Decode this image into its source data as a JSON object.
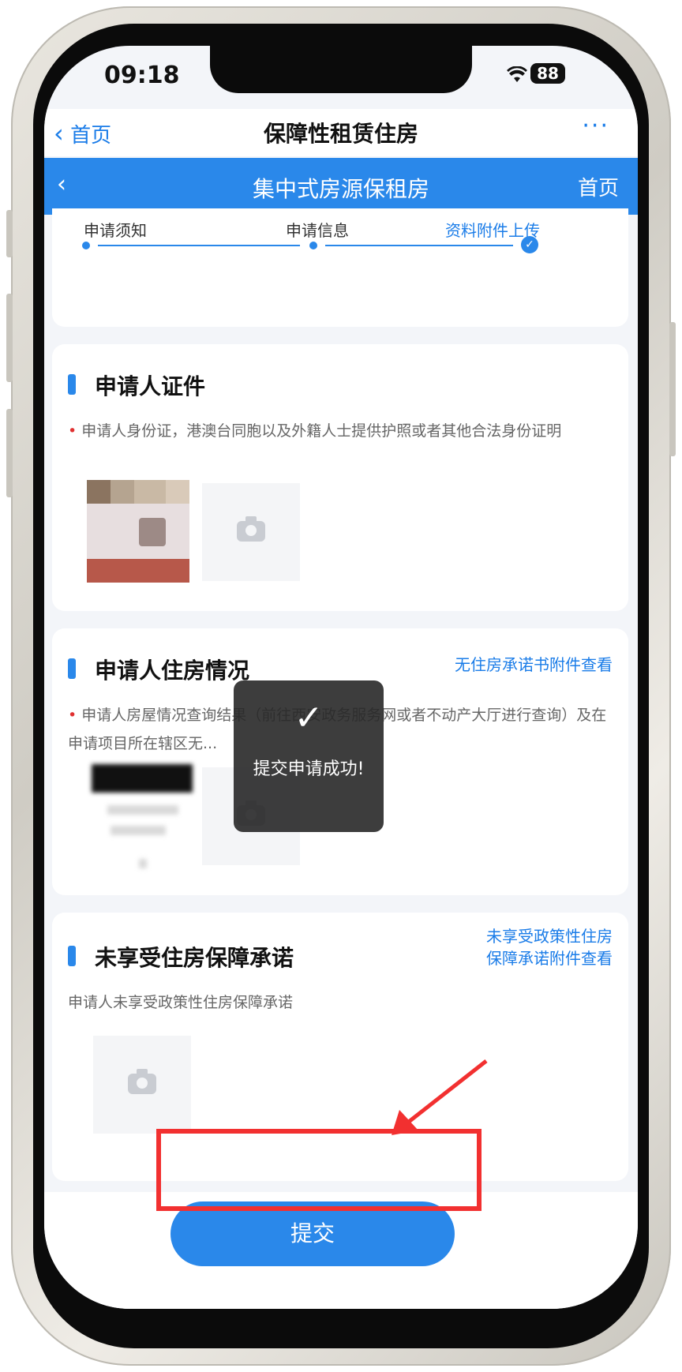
{
  "status_bar": {
    "time": "09:18",
    "battery": "88"
  },
  "top_nav": {
    "back_label": "首页",
    "title": "保障性租赁住房",
    "more": "···"
  },
  "sub_nav": {
    "back": "‹",
    "title": "集中式房源保租房",
    "home": "首页"
  },
  "steps": [
    {
      "label": "申请须知",
      "state": "done"
    },
    {
      "label": "申请信息",
      "state": "done"
    },
    {
      "label": "资料附件上传",
      "state": "current"
    }
  ],
  "sections": {
    "id_docs": {
      "title": "申请人证件",
      "description": "申请人身份证，港澳台同胞以及外籍人士提供护照或者其他合法身份证明"
    },
    "housing": {
      "title": "申请人住房情况",
      "link": "无住房承诺书附件查看",
      "description": "申请人房屋情况查询结果（前往西安政务服务网或者不动产大厅进行查询）及在申请项目所在辖区无..."
    },
    "commitment": {
      "title": "未享受住房保障承诺",
      "link_line1": "未享受政策性住房",
      "link_line2": "保障承诺附件查看",
      "description": "申请人未享受政策性住房保障承诺"
    }
  },
  "toast": {
    "icon": "check-icon",
    "message": "提交申请成功!"
  },
  "footer": {
    "submit_label": "提交"
  },
  "annotation": {
    "highlight_color": "#f23030"
  },
  "colors": {
    "accent": "#2a88ea",
    "link": "#1a7ce8",
    "required": "#e03030"
  }
}
